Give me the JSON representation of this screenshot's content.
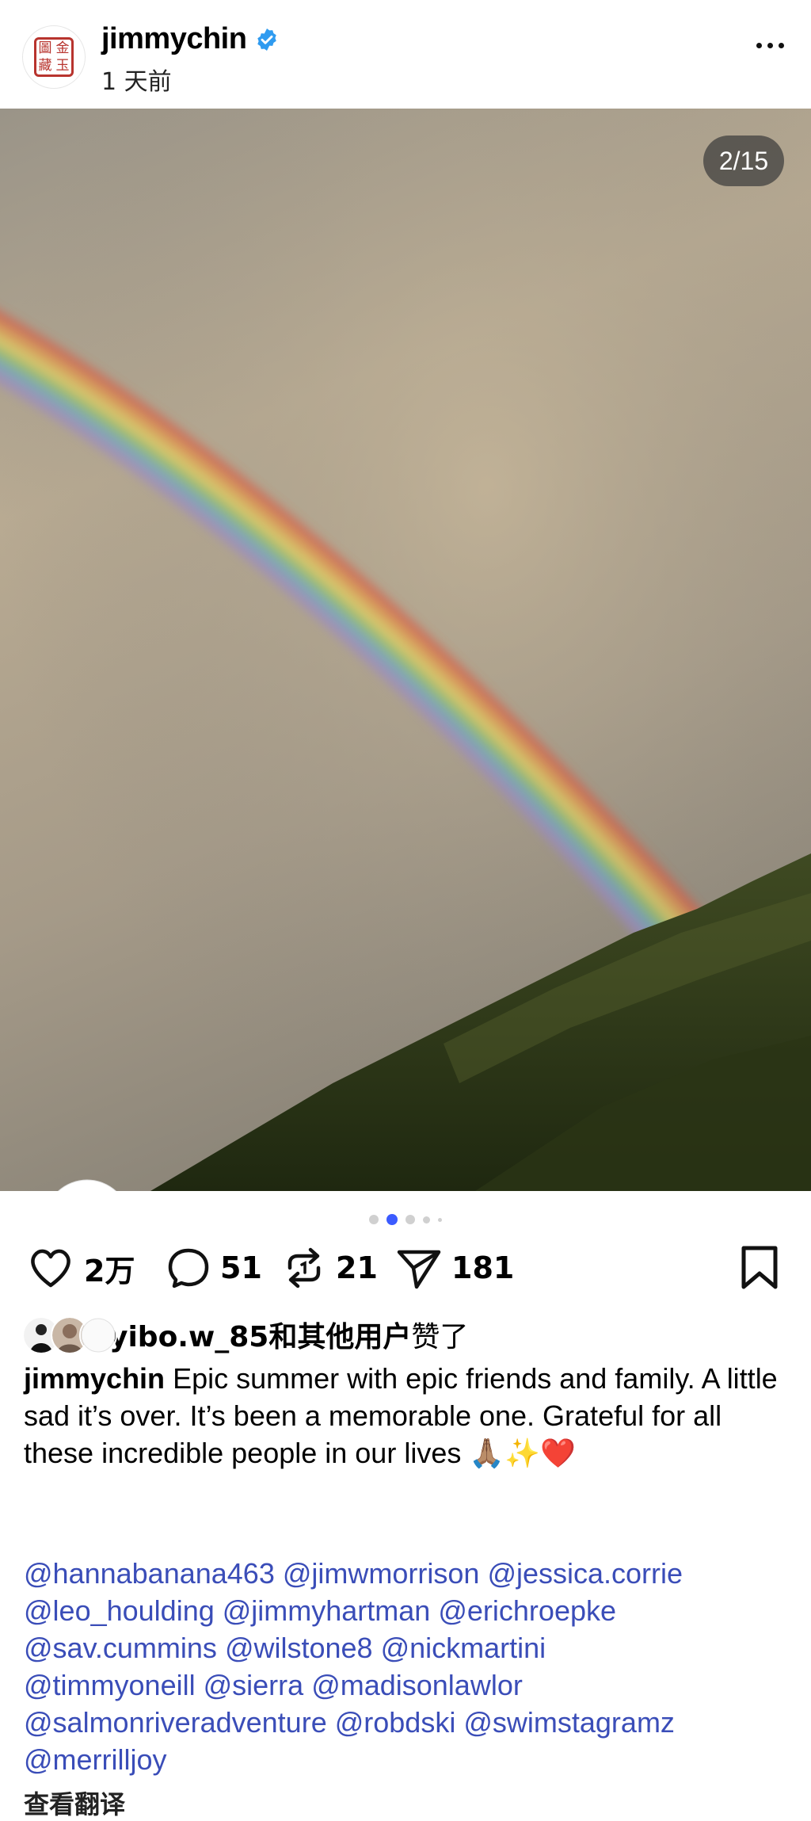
{
  "post": {
    "username": "jimmychin",
    "timestamp": "1 天前",
    "seal_chars": [
      "圖",
      "金",
      "藏",
      "玉"
    ],
    "verified_icon": "verified-badge-icon",
    "more_icon": "more-horizontal-icon"
  },
  "media": {
    "counter": "2/15",
    "tag_icon": "heart-icon"
  },
  "actions": {
    "like_count": "2万",
    "comment_count": "51",
    "repost_count": "21",
    "share_count": "181",
    "icons": [
      "heart-icon",
      "comment-icon",
      "repost-icon",
      "send-icon",
      "bookmark-icon"
    ]
  },
  "likes": {
    "user": "yibo.w_85",
    "and_others": "和其他用户",
    "suffix": "赞了"
  },
  "caption": {
    "username": "jimmychin",
    "text": "Epic summer with epic friends and family. A little sad it’s over. It’s been a memorable one. Grateful for all these incredible people in our lives 🙏🏽✨❤️"
  },
  "mentions": [
    "@hannabanana463",
    "@jimwmorrison",
    "@jessica.corrie",
    "@leo_houlding",
    "@jimmyhartman",
    "@erichroepke",
    "@sav.cummins",
    "@wilstone8",
    "@nickmartini",
    "@timmyoneill",
    "@sierra",
    "@madisonlawlor",
    "@salmonriveradventure",
    "@robdski",
    "@swimstagramz",
    "@merrilljoy"
  ],
  "translate_label": "查看翻译",
  "colors": {
    "mention": "#3a4db8",
    "verified": "#2f9bf0",
    "carousel_active": "#3b5bff"
  }
}
